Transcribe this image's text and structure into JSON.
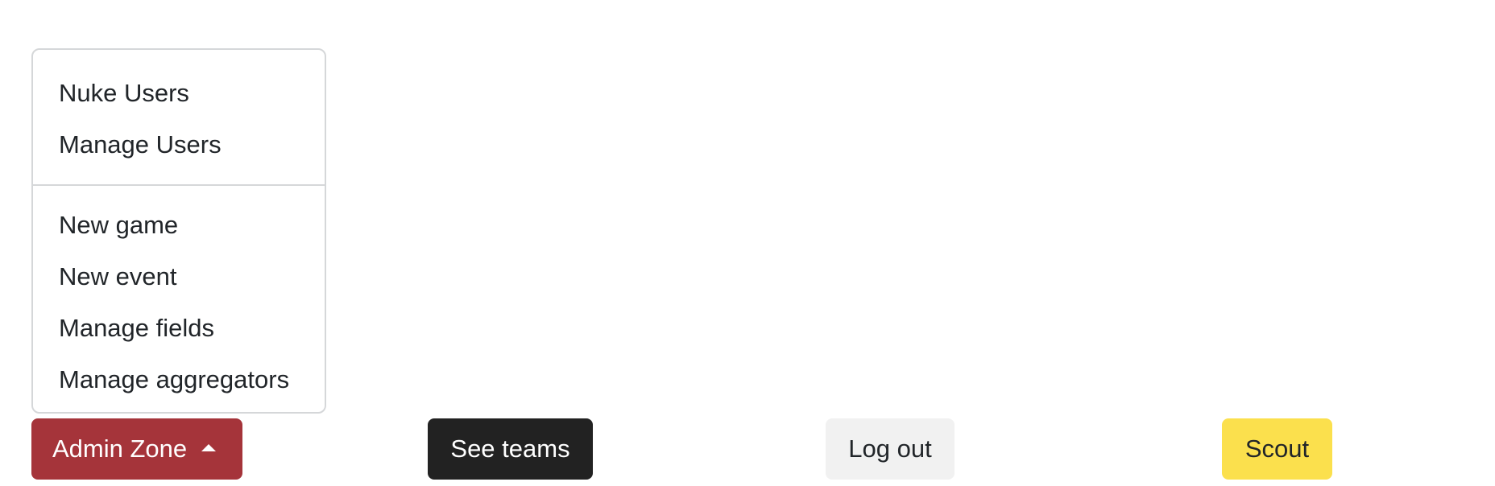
{
  "dropdown": {
    "items_group1": [
      {
        "label": "Nuke Users"
      },
      {
        "label": "Manage Users"
      }
    ],
    "items_group2": [
      {
        "label": "New game"
      },
      {
        "label": "New event"
      },
      {
        "label": "Manage fields"
      },
      {
        "label": "Manage aggregators"
      }
    ]
  },
  "buttons": {
    "admin_zone": "Admin Zone",
    "see_teams": "See teams",
    "log_out": "Log out",
    "scout": "Scout"
  },
  "icons": {
    "admin_caret": "caret-up-icon"
  },
  "colors": {
    "admin_zone_bg": "#a5343a",
    "see_teams_bg": "#222222",
    "log_out_bg": "#f1f1f1",
    "scout_bg": "#fbe04d"
  }
}
